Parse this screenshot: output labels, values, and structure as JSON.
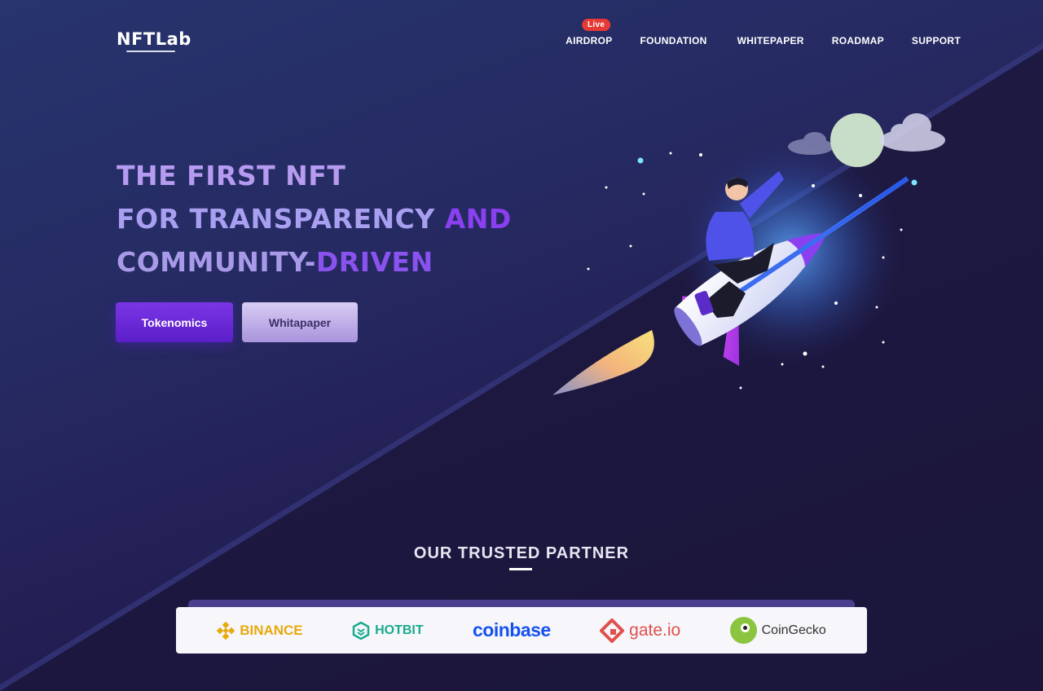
{
  "brand": {
    "logo": "NFTLab"
  },
  "nav": {
    "items": [
      {
        "label": "AIRDROP",
        "badge": "Live"
      },
      {
        "label": "FOUNDATION"
      },
      {
        "label": "WHITEPAPER"
      },
      {
        "label": "ROADMAP"
      },
      {
        "label": "SUPPORT"
      }
    ]
  },
  "hero": {
    "line1": "THE FIRST NFT",
    "line2a": "FOR TRANSPARENCY",
    "line2b": " AND",
    "line3a": "COMMUNITY-",
    "line3b": "DRIVEN",
    "primary_button": "Tokenomics",
    "secondary_button": "Whitapaper"
  },
  "partners": {
    "title": "OUR TRUSTED PARTNER",
    "items": [
      {
        "name": "BINANCE",
        "icon": "binance-icon",
        "color": "#e8a90c"
      },
      {
        "name": "HOTBIT",
        "icon": "hotbit-icon",
        "color": "#1aaa8e"
      },
      {
        "name": "coinbase",
        "icon": "",
        "color": "#1652f0"
      },
      {
        "name": "gate.io",
        "icon": "gate-icon",
        "color": "#e0514c"
      },
      {
        "name": "CoinGecko",
        "icon": "coingecko-icon",
        "color": "#8bc53f"
      }
    ]
  },
  "colors": {
    "accent": "#7a35e6",
    "live_badge": "#e53935",
    "background": "#231f54"
  }
}
